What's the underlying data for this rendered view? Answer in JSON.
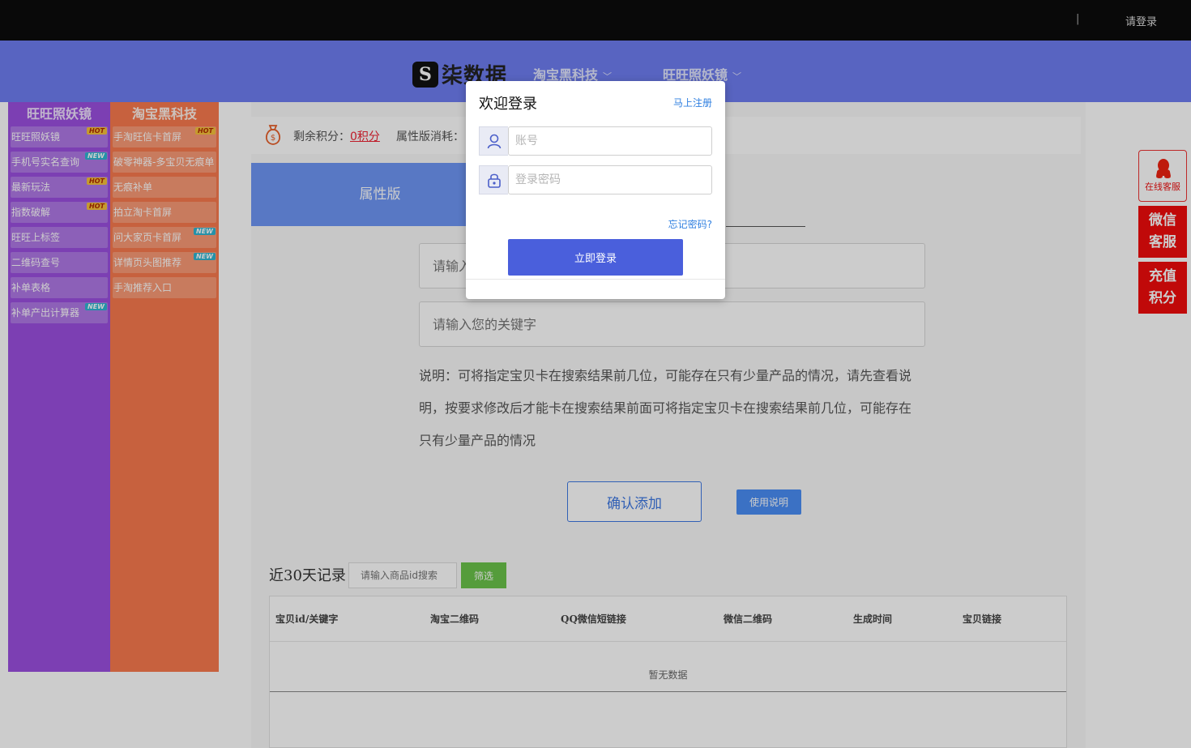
{
  "topbar": {
    "separator": "|",
    "login_link": "请登录"
  },
  "header": {
    "logo_mark": "S",
    "logo_text": "柒数据",
    "nav": [
      "淘宝黑科技",
      "旺旺照妖镜"
    ],
    "chevron": "﹀"
  },
  "left_menu": {
    "purple": {
      "title": "旺旺照妖镜",
      "items": [
        {
          "label": "旺旺照妖镜",
          "tag": "HOT"
        },
        {
          "label": "手机号实名查询",
          "tag": "NEW"
        },
        {
          "label": "最新玩法",
          "tag": "HOT"
        },
        {
          "label": "指数破解",
          "tag": "HOT"
        },
        {
          "label": "旺旺上标签",
          "tag": ""
        },
        {
          "label": "二维码查号",
          "tag": ""
        },
        {
          "label": "补单表格",
          "tag": ""
        },
        {
          "label": "补单产出计算器",
          "tag": "NEW"
        }
      ]
    },
    "orange": {
      "title": "淘宝黑科技",
      "items": [
        {
          "label": "手淘旺信卡首屏",
          "tag": "HOT"
        },
        {
          "label": "破零神器-多宝贝无痕单",
          "tag": ""
        },
        {
          "label": "无痕补单",
          "tag": ""
        },
        {
          "label": "拍立淘卡首屏",
          "tag": ""
        },
        {
          "label": "问大家页卡首屏",
          "tag": "NEW"
        },
        {
          "label": "详情页头图推荐",
          "tag": "NEW"
        },
        {
          "label": "手淘推荐入口",
          "tag": ""
        }
      ]
    }
  },
  "main": {
    "points_label": "剩余积分：",
    "points_value": "0积分",
    "consume_label": "属性版消耗：",
    "tab_active": "属性版",
    "field1_placeholder": "请输入",
    "field2_placeholder": "请输入您的关键字",
    "description": "说明：可将指定宝贝卡在搜索结果前几位，可能存在只有少量产品的情况，请先查看说明，按要求修改后才能卡在搜索结果前面可将指定宝贝卡在搜索结果前几位，可能存在只有少量产品的情况",
    "confirm_button": "确认添加",
    "help_button": "使用说明",
    "records_title": "近30天记录",
    "records_search_placeholder": "请输入商品id搜索",
    "filter_button": "筛选",
    "table_headers": [
      "宝贝id/关键字",
      "淘宝二维码",
      "QQ微信短链接",
      "微信二维码",
      "生成时间",
      "宝贝链接"
    ],
    "no_data": "暂无数据"
  },
  "float": {
    "service_label": "在线客服",
    "wechat_label": [
      "微信",
      "客服"
    ],
    "recharge_label": [
      "充值",
      "积分"
    ]
  },
  "modal": {
    "title": "欢迎登录",
    "register_link": "马上注册",
    "account_placeholder": "账号",
    "password_placeholder": "登录密码",
    "forgot_link": "忘记密码?",
    "submit_button": "立即登录"
  }
}
